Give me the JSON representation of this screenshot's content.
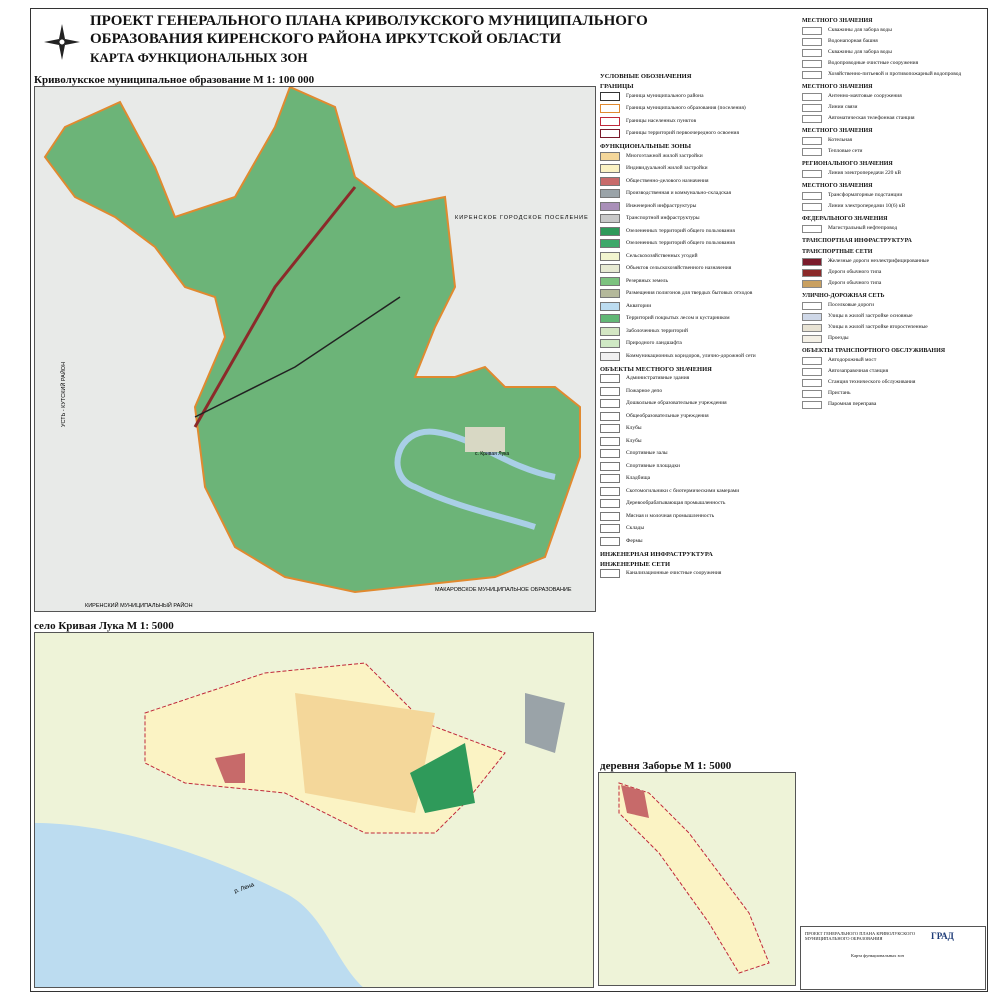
{
  "title": "ПРОЕКТ ГЕНЕРАЛЬНОГО ПЛАНА КРИВОЛУКСКОГО МУНИЦИПАЛЬНОГО ОБРАЗОВАНИЯ КИРЕНСКОГО РАЙОНА ИРКУТСКОЙ ОБЛАСТИ",
  "subtitle": "КАРТА ФУНКЦИОНАЛЬНЫХ ЗОН",
  "maps": {
    "overview_label": "Криволукское муниципальное образование М 1: 100 000",
    "village_label": "село Кривая Лука М 1: 5000",
    "hamlet_label": "деревня Заборье М 1: 5000"
  },
  "overview_places": {
    "kirensk": "КИРЕНСКОЕ ГОРОДСКОЕ ПОСЕЛЕНИЕ",
    "ust_kut": "УСТЬ - КУТСКИЙ РАЙОН",
    "kirensky": "КИРЕНСКИЙ МУНИЦИПАЛЬНЫЙ РАЙОН",
    "makarovo": "МАКАРОВСКОЕ МУНИЦИПАЛЬНОЕ ОБРАЗОВАНИЕ",
    "village": "с. Кривая Лука"
  },
  "village_places": {
    "river": "р. Лена"
  },
  "legend": {
    "header": "УСЛОВНЫЕ ОБОЗНАЧЕНИЯ",
    "borders_header": "ГРАНИЦЫ",
    "borders": [
      {
        "label": "Граница муниципального района",
        "color": "#333333"
      },
      {
        "label": "Граница муниципального образования (поселения)",
        "color": "#e08a30"
      },
      {
        "label": "Границы населенных пунктов",
        "color": "#c0283a"
      },
      {
        "label": "Границы территорий первоочередного освоения",
        "color": "#7a1b2b"
      }
    ],
    "zones_header": "ФУНКЦИОНАЛЬНЫЕ ЗОНЫ",
    "zones": [
      {
        "label": "Многоэтажной жилой застройки",
        "color": "#f4d79a"
      },
      {
        "label": "Индивидуальной жилой застройки",
        "color": "#fbf3c4"
      },
      {
        "label": "Общественно-делового назначения",
        "color": "#c76a6a"
      },
      {
        "label": "Производственная и коммунально-складская",
        "color": "#9aa3a8"
      },
      {
        "label": "Инженерной инфраструктуры",
        "color": "#a98fb8"
      },
      {
        "label": "Транспортной инфраструктуры",
        "color": "#c9c9c9"
      },
      {
        "label": "Озелененных территорий общего пользования",
        "color": "#2f9a5a"
      },
      {
        "label": "Озелененных территорий общего пользования",
        "color": "#3ea86a"
      },
      {
        "label": "Сельскохозяйственных угодий",
        "color": "#f2f5cf"
      },
      {
        "label": "Объектов сельскохозяйственного назначения",
        "color": "#e7ead3"
      },
      {
        "label": "Резервных земель",
        "color": "#7cc27f"
      },
      {
        "label": "Размещения полигонов для твердых бытовых отходов",
        "color": "#b4b89a"
      },
      {
        "label": "Акватории",
        "color": "#bcdcf0"
      },
      {
        "label": "Территорий покрытых лесом и кустарником",
        "color": "#62b775"
      },
      {
        "label": "Заболоченных территорий",
        "color": "#d3e6c3"
      },
      {
        "label": "Природного ландшафта",
        "color": "#cfe9c4"
      },
      {
        "label": "Коммуникационных коридоров, улично-дорожной сети",
        "color": "#f0f0f0"
      }
    ],
    "objects_header": "ОБЪЕКТЫ МЕСТНОГО ЗНАЧЕНИЯ",
    "objects": [
      "Административные здания",
      "Пожарное депо",
      "Дошкольные образовательные учреждения",
      "Общеобразовательные учреждения",
      "Клубы",
      "Клубы",
      "Спортивные залы",
      "Спортивные площадки",
      "Кладбища",
      "Скотомогильники с биотермическими камерами",
      "Деревообрабатывающая промышленность",
      "Мясная и молочная промышленность",
      "Склады",
      "Фермы"
    ],
    "eng_header": "ИНЖЕНЕРНАЯ ИНФРАСТРУКТУРА",
    "eng_sub": "ИНЖЕНЕРНЫЕ СЕТИ",
    "eng_item": "Канализационные очистные сооружения"
  },
  "legend2": {
    "items": [
      {
        "group": "МЕСТНОГО ЗНАЧЕНИЯ",
        "label": "Скважины для забора воды"
      },
      {
        "group": "",
        "label": "Водонапорная башня"
      },
      {
        "group": "",
        "label": "Скважины для забора воды"
      },
      {
        "group": "",
        "label": "Водопроводные очистные сооружения"
      },
      {
        "group": "",
        "label": "Хозяйственно-питьевой и противопожарный водопровод"
      },
      {
        "group": "МЕСТНОГО ЗНАЧЕНИЯ",
        "label": "Антенно-мачтовые сооружения"
      },
      {
        "group": "",
        "label": "Линии связи"
      },
      {
        "group": "",
        "label": "Автоматическая телефонная станция"
      },
      {
        "group": "МЕСТНОГО ЗНАЧЕНИЯ",
        "label": "Котельная"
      },
      {
        "group": "",
        "label": "Тепловые сети"
      },
      {
        "group": "РЕГИОНАЛЬНОГО ЗНАЧЕНИЯ",
        "label": "Линия электропередачи 220 кВ"
      },
      {
        "group": "МЕСТНОГО ЗНАЧЕНИЯ",
        "label": "Трансформаторные подстанции"
      },
      {
        "group": "",
        "label": "Линии электропередачи 10(6) кВ"
      },
      {
        "group": "ФЕДЕРАЛЬНОГО ЗНАЧЕНИЯ",
        "label": "Магистральный нефтепровод"
      }
    ],
    "transport_header": "ТРАНСПОРТНАЯ ИНФРАСТРУКТУРА",
    "transport_sub": "ТРАНСПОРТНЫЕ СЕТИ",
    "transport": [
      {
        "label": "Железные дороги неэлектрифицированные",
        "color": "#7a1b2b"
      },
      {
        "label": "Дороги обычного типа",
        "color": "#8b2a2a"
      },
      {
        "label": "Дороги обычного типа",
        "color": "#c9a060"
      }
    ],
    "streets_header": "УЛИЧНО-ДОРОЖНАЯ СЕТЬ",
    "streets": [
      {
        "label": "Поселковые дороги",
        "color": "#ffffff"
      },
      {
        "label": "Улицы в жилой застройке основные",
        "color": "#cfd8e8"
      },
      {
        "label": "Улицы в жилой застройке второстепенные",
        "color": "#e8e3d4"
      },
      {
        "label": "Проезды",
        "color": "#f4f0e6"
      }
    ],
    "service_header": "ОБЪЕКТЫ ТРАНСПОРТНОГО ОБСЛУЖИВАНИЯ",
    "service": [
      "Автодорожный мост",
      "Автозаправочная станция",
      "Станция технического обслуживания",
      "Пристань",
      "Паромная переправа"
    ]
  },
  "stamp": {
    "line1": "ПРОЕКТ ГЕНЕРАЛЬНОГО ПЛАНА КРИВОЛУКСКОГО МУНИЦИПАЛЬНОГО ОБРАЗОВАНИЯ",
    "line2": "Карта функциональных зон",
    "logo": "ГРАД"
  }
}
